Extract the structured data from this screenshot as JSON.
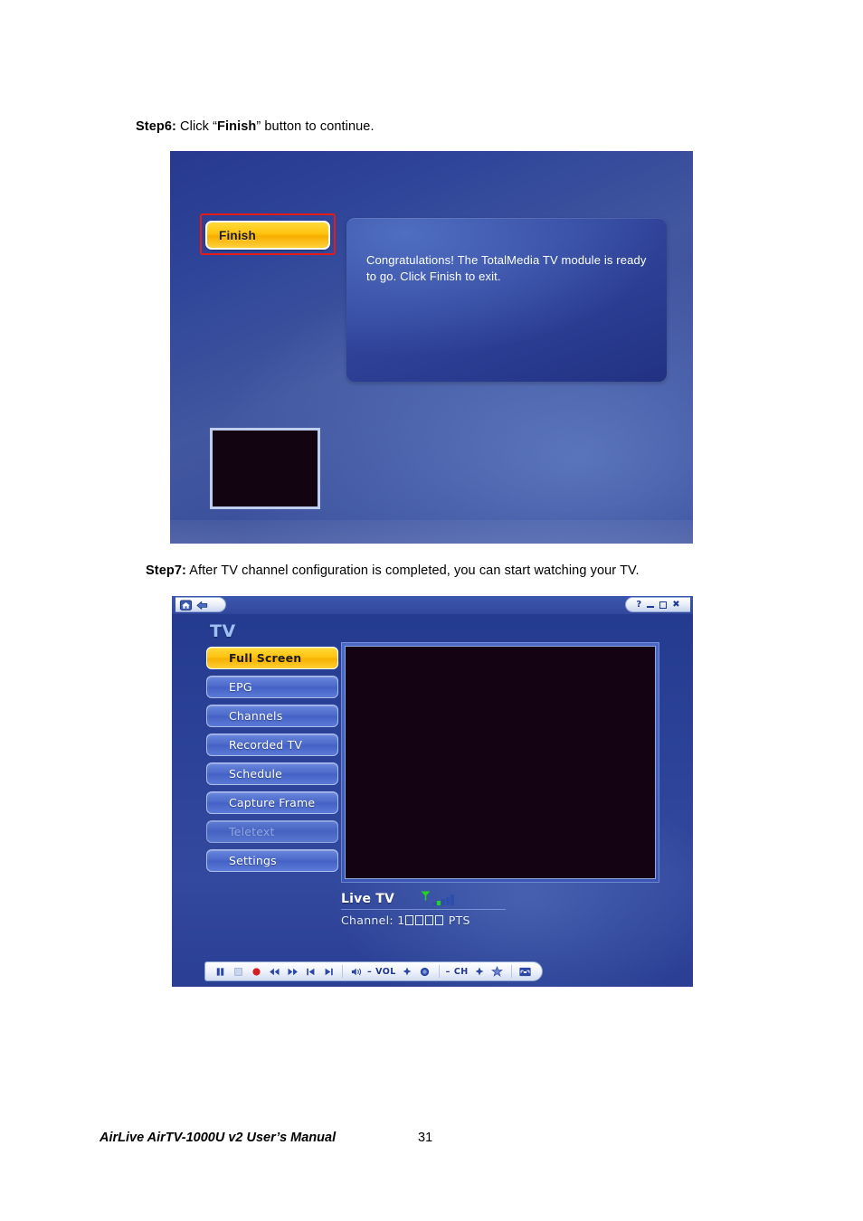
{
  "document": {
    "step6": {
      "label": "Step6:",
      "text_before": " Click “",
      "emphasis": "Finish",
      "text_after": "” button to continue."
    },
    "step7": {
      "label": "Step7:",
      "text": " After TV channel configuration is completed, you can start watching your TV."
    },
    "footer": {
      "title": "AirLive AirTV-1000U v2 User’s Manual",
      "page_number": "31"
    }
  },
  "screenshot1": {
    "finish_button_label": "Finish",
    "highlight_color": "#e41b17",
    "message": "Congratulations! The TotalMedia TV module is ready to go. Click Finish to exit."
  },
  "screenshot2": {
    "titlebar": {
      "home_icon": "home-icon",
      "back_icon": "back-arrow-icon",
      "help_label": "?",
      "minimize_label": "minimize-icon",
      "maximize_label": "maximize-icon",
      "close_label": "✖"
    },
    "heading": "TV",
    "menu": [
      {
        "label": "Full Screen",
        "state": "active"
      },
      {
        "label": "EPG",
        "state": "normal"
      },
      {
        "label": "Channels",
        "state": "normal"
      },
      {
        "label": "Recorded TV",
        "state": "normal"
      },
      {
        "label": "Schedule",
        "state": "normal"
      },
      {
        "label": "Capture Frame",
        "state": "normal"
      },
      {
        "label": "Teletext",
        "state": "disabled"
      },
      {
        "label": "Settings",
        "state": "normal"
      }
    ],
    "status": {
      "mode_label": "Live TV",
      "signal_icon": "antenna-icon",
      "signal_bars_total": 5,
      "signal_bars_on": 1,
      "channel_prefix": "Channel: 1",
      "channel_missing_glyphs": 4,
      "channel_suffix": "PTS"
    },
    "controls": {
      "transport": [
        "pause-icon",
        "stop-icon",
        "record-icon",
        "rewind-icon",
        "fast-forward-icon",
        "previous-icon",
        "next-icon"
      ],
      "volume_icon": "speaker-icon",
      "volume_minus": "–",
      "volume_label": "VOL",
      "volume_plus": "✦",
      "mute_icon": "mute-icon",
      "channel_minus": "–",
      "channel_label": "CH",
      "channel_plus": "✦",
      "favorites_icon": "star-icon",
      "fullscreen_icon": "fullscreen-icon"
    }
  }
}
